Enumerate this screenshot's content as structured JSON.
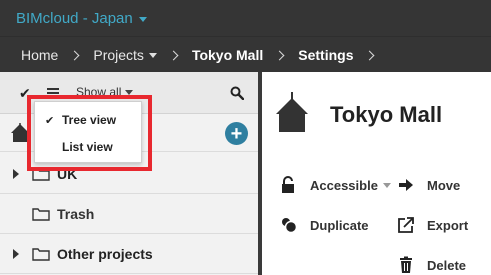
{
  "header": {
    "brand": "BIMcloud - Japan"
  },
  "breadcrumb": {
    "items": [
      "Home",
      "Projects",
      "Tokyo Mall",
      "Settings"
    ]
  },
  "tree": {
    "toolbar": {
      "filter_label": "Show all"
    },
    "view_menu": {
      "items": [
        {
          "label": "Tree view",
          "selected": true
        },
        {
          "label": "List view",
          "selected": false
        }
      ]
    },
    "rows": [
      {
        "label": "UK",
        "expandable": true
      },
      {
        "label": "Trash",
        "expandable": false
      },
      {
        "label": "Other projects",
        "expandable": true
      }
    ]
  },
  "detail": {
    "title": "Tokyo Mall",
    "actions": {
      "accessible": "Accessible",
      "move": "Move",
      "duplicate": "Duplicate",
      "export": "Export",
      "delete": "Delete"
    }
  },
  "colors": {
    "accent": "#41a9c7",
    "topbar": "#353535",
    "highlight": "#e8282f",
    "add_button": "#2f7fa0"
  }
}
